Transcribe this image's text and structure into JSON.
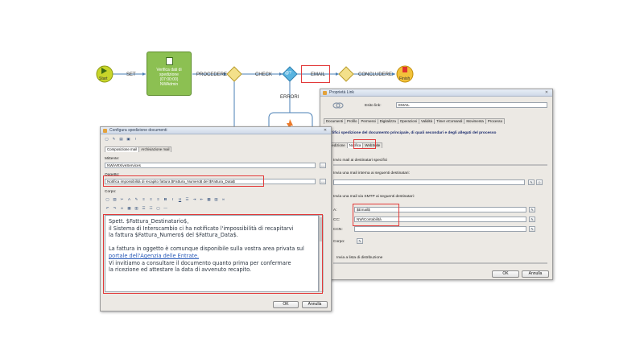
{
  "workflow": {
    "start_label": "Start",
    "finish_label": "Finish",
    "task_lines": [
      "Verifica dati di",
      "spedizione",
      "(07:00:00)",
      "NWAdmin"
    ],
    "edges": {
      "set": "SET",
      "procedere": "PROCEDERE",
      "check": "CHECK",
      "email": "EMAIL",
      "concludere": "CONCLUDERE",
      "errori": "ERRORI"
    },
    "decision_label": "@?"
  },
  "properties_window": {
    "title": "Proprietà Link",
    "esito_label": "Esito link:",
    "esito_value": "EMAIL",
    "tabs": [
      "Documenti",
      "Profilo",
      "Permessi",
      "Digitalizza",
      "Operazioni",
      "Validità",
      "Timer eComandi",
      "Movimenta",
      "Processo"
    ],
    "description": "Modifici spedizione del documento principale, di quali secondari e degli allegati del processo",
    "subtabs": [
      "Spedizione",
      "Notifica",
      "WebSuite"
    ],
    "check_specific": "Invio mail ai destinatari specifici",
    "internal_label": "Invia una mail interna ai seguenti destinatari:",
    "smtp_label": "Invia una mail via SMTP ai seguenti destinatari:",
    "a_label": "A:",
    "a_value": "$Email$",
    "cc_label": "CC:",
    "cc_value": "NW\\Contabilità",
    "ccn_label": "CCN:",
    "corpo_label": "Corpo:",
    "distribution": "Invia a lista di distribuzione",
    "ok": "OK",
    "annulla": "Annulla"
  },
  "config_window": {
    "title": "Configura spedizione documenti",
    "tabs": [
      "Composizione mail",
      "Archiviazione mail"
    ],
    "mittente_label": "Mittente:",
    "mittente_value": "NW\\ARXiveServices",
    "oggetto_label": "Oggetto:",
    "oggetto_value": "Notifica impossibilità di recapito fattura $Fattura_Numero$ del $Fattura_Data$",
    "corpo_label": "Corpo:",
    "body_lines": [
      "Spett. $Fattura_Destinatario$,",
      "il Sistema di Interscambio ci ha notificato l'impossibilità di recapitarvi",
      "la fattura $Fattura_Numero$ del $Fattura_Data$.",
      "",
      "La fattura in oggetto è comunque disponibile sulla vostra area privata sul",
      "portale dell'Agenzia delle Entrate.",
      "Vi invitiamo a consultare il documento quanto prima per confermare",
      "la ricezione ed attestare la data di avvenuto recapito."
    ],
    "ok": "OK",
    "annulla": "Annulla"
  },
  "colors": {
    "highlight": "#e23a3a",
    "start_fill": "#c8d52a",
    "finish_fill": "#f2c23a",
    "task_fill": "#8cc052",
    "decision_fill": "#f3e08a",
    "decision_blue": "#59b4e0"
  }
}
